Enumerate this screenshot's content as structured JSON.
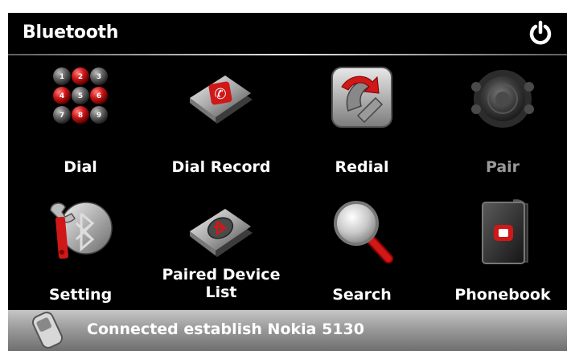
{
  "header": {
    "title": "Bluetooth",
    "power_icon": "power-icon"
  },
  "menu": [
    {
      "label": "Dial",
      "icon": "dialpad-icon",
      "enabled": true
    },
    {
      "label": "Dial Record",
      "icon": "call-record-icon",
      "enabled": true
    },
    {
      "label": "Redial",
      "icon": "redial-icon",
      "enabled": true
    },
    {
      "label": "Pair",
      "icon": "pair-speaker-icon",
      "enabled": false
    },
    {
      "label": "Setting",
      "icon": "bluetooth-settings-icon",
      "enabled": true
    },
    {
      "label": "Paired Device\nList",
      "icon": "paired-device-list-icon",
      "enabled": true
    },
    {
      "label": "Search",
      "icon": "magnifier-icon",
      "enabled": true
    },
    {
      "label": "Phonebook",
      "icon": "phonebook-icon",
      "enabled": true
    }
  ],
  "status": {
    "text": "Connected establish Nokia 5130",
    "icon": "phone-handset-icon"
  },
  "colors": {
    "background": "#000000",
    "text": "#ffffff",
    "disabled_text": "#9a9a9a",
    "accent_red": "#d01818",
    "status_bar": "#9b9b9b"
  }
}
